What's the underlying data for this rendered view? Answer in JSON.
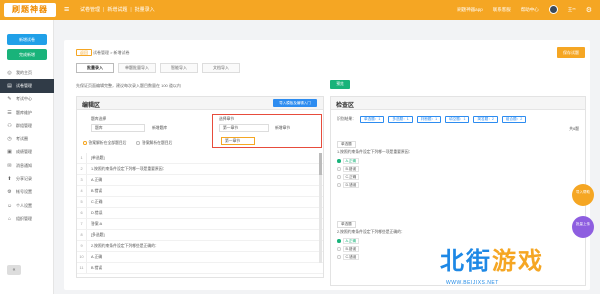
{
  "topbar": {
    "logo": "刷题神器",
    "crumbs": [
      "试卷管理",
      "|",
      "新增试题",
      "|",
      "批量录入"
    ],
    "right_links": [
      "刷题神器app",
      "联系客服",
      "帮助中心"
    ],
    "user_name": "王**"
  },
  "sidebar": {
    "btn_new_exam": "新增试卷",
    "btn_new_question": "完成新增",
    "menu": [
      {
        "icon": "◎",
        "label": "我的主页",
        "active": false
      },
      {
        "icon": "▤",
        "label": "试卷管理",
        "active": true
      },
      {
        "icon": "✎",
        "label": "考试中心",
        "active": false
      },
      {
        "icon": "☰",
        "label": "题库维护",
        "active": false
      },
      {
        "icon": "⚇",
        "label": "群组管理",
        "active": false
      },
      {
        "icon": "◷",
        "label": "考试圈",
        "active": false
      },
      {
        "icon": "▣",
        "label": "成绩管理",
        "active": false
      },
      {
        "icon": "✉",
        "label": "消息通知",
        "active": false
      },
      {
        "icon": "⬆",
        "label": "分享记录",
        "active": false
      },
      {
        "icon": "⚙",
        "label": "帐号设置",
        "active": false
      },
      {
        "icon": "☺",
        "label": "个人设置",
        "active": false
      },
      {
        "icon": "⌂",
        "label": "组织管理",
        "active": false
      }
    ],
    "collapse_label": "«"
  },
  "main": {
    "tag": "返回",
    "sub_crumb": "试卷管理 > 新增试卷",
    "save_label": "保存试题",
    "tabs": [
      "批量录入",
      "单题批量导入",
      "智能导入",
      "文档导入"
    ],
    "hint": "先保证页面编辑完整，建议每次录入题目数量在 100 道以内"
  },
  "editor": {
    "title": "编辑区",
    "import_btn": "导入模板及编辑入门",
    "label_source": "题库选择",
    "source_value": "题库",
    "label_new": "新增题库",
    "label_chapter": "选择章节",
    "chapter_value": "第一章节",
    "label_new_chapter": "新增章节",
    "radio_on": "答案解析在全部题目后",
    "radio_off": "答案解析在题目后",
    "dropdown_value": "第一章节",
    "lines": [
      {
        "n": "1",
        "t": "[单选题]"
      },
      {
        "n": "2",
        "t": "1.按照约束条件设定下列哪一项是重要原因："
      },
      {
        "n": "3",
        "t": "A.正确"
      },
      {
        "n": "4",
        "t": "B.错误"
      },
      {
        "n": "5",
        "t": "C.正确"
      },
      {
        "n": "6",
        "t": "D.错误"
      },
      {
        "n": "7",
        "t": "答案:A"
      },
      {
        "n": "8",
        "t": "[多选题]"
      },
      {
        "n": "9",
        "t": "2.按照约束条件设定下列哪些是正确的："
      },
      {
        "n": "10",
        "t": "A.正确"
      },
      {
        "n": "11",
        "t": "B.错误"
      }
    ]
  },
  "check": {
    "green_btn": "预览",
    "title": "检查区",
    "stats_label": "识别结果：",
    "stats": [
      "单选题：1",
      "多选题：1",
      "判断题：1",
      "填空题：1",
      "简答题：2",
      "组合题：2"
    ],
    "total": "共6题",
    "q1_type": "单选题",
    "q1_stem": "1.按照约束条件设定下列哪一项是重要原因：",
    "q1_opts": [
      "A.正确",
      "B.错误",
      "C.正确",
      "D.错误"
    ],
    "q2_type": "单选题",
    "q2_stem": "2.按照约束条件设定下列哪些是正确的：",
    "q2_opts": [
      "A.正确",
      "B.错误",
      "C.错误"
    ]
  },
  "floats": {
    "f1": "导入帮助",
    "f2": "批量上传"
  },
  "watermark": {
    "text1": "北街",
    "text2": "游戏",
    "url": "WWW.BEIJIXS.NET"
  }
}
